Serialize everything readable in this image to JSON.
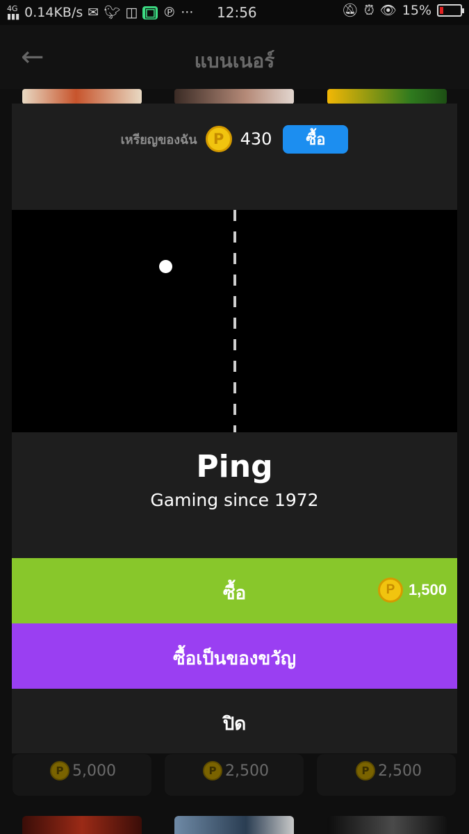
{
  "status_bar": {
    "network": "4G",
    "speed": "0.14KB/s",
    "time": "12:56",
    "battery": "15%",
    "icons": [
      "signal-icon",
      "gmail-icon",
      "twitter-icon",
      "instagram-icon",
      "android-icon",
      "pinterest-icon",
      "more-icon",
      "mute-icon",
      "alarm-icon",
      "eye-icon",
      "battery-icon"
    ]
  },
  "app_bar": {
    "title": "แบนเนอร์"
  },
  "background": {
    "prices": [
      "5,000",
      "2,500",
      "2,500"
    ]
  },
  "modal": {
    "my_coins_label": "เหรียญของฉัน",
    "coin_symbol": "P",
    "my_coins": "430",
    "buy_coins_label": "ซื้อ",
    "theme_name": "Ping",
    "theme_subtitle": "Gaming since 1972",
    "buy_label": "ซื้อ",
    "price": "1,500",
    "gift_label": "ซื้อเป็นของขวัญ",
    "close_label": "ปิด"
  },
  "colors": {
    "buy_button": "#88c72b",
    "gift_button": "#9a3ff2",
    "buy_coins_button": "#1c8ef0",
    "coin": "#f1c40f"
  }
}
